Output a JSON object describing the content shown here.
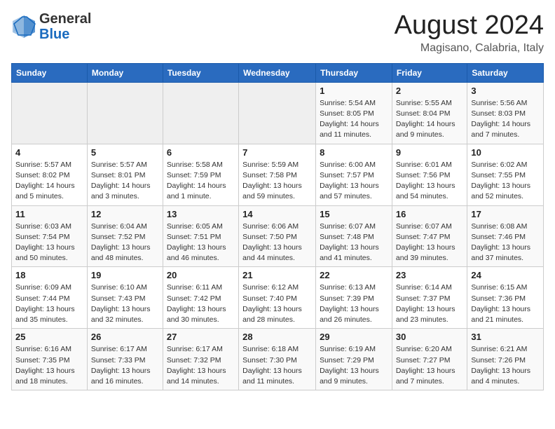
{
  "logo": {
    "general": "General",
    "blue": "Blue"
  },
  "title": "August 2024",
  "location": "Magisano, Calabria, Italy",
  "weekdays": [
    "Sunday",
    "Monday",
    "Tuesday",
    "Wednesday",
    "Thursday",
    "Friday",
    "Saturday"
  ],
  "weeks": [
    [
      {
        "day": "",
        "sunrise": "",
        "sunset": "",
        "daylight": ""
      },
      {
        "day": "",
        "sunrise": "",
        "sunset": "",
        "daylight": ""
      },
      {
        "day": "",
        "sunrise": "",
        "sunset": "",
        "daylight": ""
      },
      {
        "day": "",
        "sunrise": "",
        "sunset": "",
        "daylight": ""
      },
      {
        "day": "1",
        "sunrise": "Sunrise: 5:54 AM",
        "sunset": "Sunset: 8:05 PM",
        "daylight": "Daylight: 14 hours and 11 minutes."
      },
      {
        "day": "2",
        "sunrise": "Sunrise: 5:55 AM",
        "sunset": "Sunset: 8:04 PM",
        "daylight": "Daylight: 14 hours and 9 minutes."
      },
      {
        "day": "3",
        "sunrise": "Sunrise: 5:56 AM",
        "sunset": "Sunset: 8:03 PM",
        "daylight": "Daylight: 14 hours and 7 minutes."
      }
    ],
    [
      {
        "day": "4",
        "sunrise": "Sunrise: 5:57 AM",
        "sunset": "Sunset: 8:02 PM",
        "daylight": "Daylight: 14 hours and 5 minutes."
      },
      {
        "day": "5",
        "sunrise": "Sunrise: 5:57 AM",
        "sunset": "Sunset: 8:01 PM",
        "daylight": "Daylight: 14 hours and 3 minutes."
      },
      {
        "day": "6",
        "sunrise": "Sunrise: 5:58 AM",
        "sunset": "Sunset: 7:59 PM",
        "daylight": "Daylight: 14 hours and 1 minute."
      },
      {
        "day": "7",
        "sunrise": "Sunrise: 5:59 AM",
        "sunset": "Sunset: 7:58 PM",
        "daylight": "Daylight: 13 hours and 59 minutes."
      },
      {
        "day": "8",
        "sunrise": "Sunrise: 6:00 AM",
        "sunset": "Sunset: 7:57 PM",
        "daylight": "Daylight: 13 hours and 57 minutes."
      },
      {
        "day": "9",
        "sunrise": "Sunrise: 6:01 AM",
        "sunset": "Sunset: 7:56 PM",
        "daylight": "Daylight: 13 hours and 54 minutes."
      },
      {
        "day": "10",
        "sunrise": "Sunrise: 6:02 AM",
        "sunset": "Sunset: 7:55 PM",
        "daylight": "Daylight: 13 hours and 52 minutes."
      }
    ],
    [
      {
        "day": "11",
        "sunrise": "Sunrise: 6:03 AM",
        "sunset": "Sunset: 7:54 PM",
        "daylight": "Daylight: 13 hours and 50 minutes."
      },
      {
        "day": "12",
        "sunrise": "Sunrise: 6:04 AM",
        "sunset": "Sunset: 7:52 PM",
        "daylight": "Daylight: 13 hours and 48 minutes."
      },
      {
        "day": "13",
        "sunrise": "Sunrise: 6:05 AM",
        "sunset": "Sunset: 7:51 PM",
        "daylight": "Daylight: 13 hours and 46 minutes."
      },
      {
        "day": "14",
        "sunrise": "Sunrise: 6:06 AM",
        "sunset": "Sunset: 7:50 PM",
        "daylight": "Daylight: 13 hours and 44 minutes."
      },
      {
        "day": "15",
        "sunrise": "Sunrise: 6:07 AM",
        "sunset": "Sunset: 7:48 PM",
        "daylight": "Daylight: 13 hours and 41 minutes."
      },
      {
        "day": "16",
        "sunrise": "Sunrise: 6:07 AM",
        "sunset": "Sunset: 7:47 PM",
        "daylight": "Daylight: 13 hours and 39 minutes."
      },
      {
        "day": "17",
        "sunrise": "Sunrise: 6:08 AM",
        "sunset": "Sunset: 7:46 PM",
        "daylight": "Daylight: 13 hours and 37 minutes."
      }
    ],
    [
      {
        "day": "18",
        "sunrise": "Sunrise: 6:09 AM",
        "sunset": "Sunset: 7:44 PM",
        "daylight": "Daylight: 13 hours and 35 minutes."
      },
      {
        "day": "19",
        "sunrise": "Sunrise: 6:10 AM",
        "sunset": "Sunset: 7:43 PM",
        "daylight": "Daylight: 13 hours and 32 minutes."
      },
      {
        "day": "20",
        "sunrise": "Sunrise: 6:11 AM",
        "sunset": "Sunset: 7:42 PM",
        "daylight": "Daylight: 13 hours and 30 minutes."
      },
      {
        "day": "21",
        "sunrise": "Sunrise: 6:12 AM",
        "sunset": "Sunset: 7:40 PM",
        "daylight": "Daylight: 13 hours and 28 minutes."
      },
      {
        "day": "22",
        "sunrise": "Sunrise: 6:13 AM",
        "sunset": "Sunset: 7:39 PM",
        "daylight": "Daylight: 13 hours and 26 minutes."
      },
      {
        "day": "23",
        "sunrise": "Sunrise: 6:14 AM",
        "sunset": "Sunset: 7:37 PM",
        "daylight": "Daylight: 13 hours and 23 minutes."
      },
      {
        "day": "24",
        "sunrise": "Sunrise: 6:15 AM",
        "sunset": "Sunset: 7:36 PM",
        "daylight": "Daylight: 13 hours and 21 minutes."
      }
    ],
    [
      {
        "day": "25",
        "sunrise": "Sunrise: 6:16 AM",
        "sunset": "Sunset: 7:35 PM",
        "daylight": "Daylight: 13 hours and 18 minutes."
      },
      {
        "day": "26",
        "sunrise": "Sunrise: 6:17 AM",
        "sunset": "Sunset: 7:33 PM",
        "daylight": "Daylight: 13 hours and 16 minutes."
      },
      {
        "day": "27",
        "sunrise": "Sunrise: 6:17 AM",
        "sunset": "Sunset: 7:32 PM",
        "daylight": "Daylight: 13 hours and 14 minutes."
      },
      {
        "day": "28",
        "sunrise": "Sunrise: 6:18 AM",
        "sunset": "Sunset: 7:30 PM",
        "daylight": "Daylight: 13 hours and 11 minutes."
      },
      {
        "day": "29",
        "sunrise": "Sunrise: 6:19 AM",
        "sunset": "Sunset: 7:29 PM",
        "daylight": "Daylight: 13 hours and 9 minutes."
      },
      {
        "day": "30",
        "sunrise": "Sunrise: 6:20 AM",
        "sunset": "Sunset: 7:27 PM",
        "daylight": "Daylight: 13 hours and 7 minutes."
      },
      {
        "day": "31",
        "sunrise": "Sunrise: 6:21 AM",
        "sunset": "Sunset: 7:26 PM",
        "daylight": "Daylight: 13 hours and 4 minutes."
      }
    ]
  ]
}
